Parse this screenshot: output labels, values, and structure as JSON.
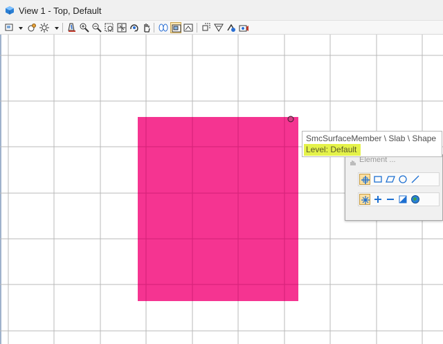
{
  "window": {
    "title": "View 1 - Top, Default",
    "app_icon": "view-cube-icon"
  },
  "toolbar": {
    "icons": [
      "view-attributes-icon",
      "dropdown-arrow-icon",
      "display-style-icon",
      "brightness-icon",
      "dropdown-arrow-icon",
      "update-view-icon",
      "zoom-in-icon",
      "zoom-out-icon",
      "window-area-icon",
      "fit-view-icon",
      "rotate-view-icon",
      "pan-view-icon",
      "view-previous-next-icon",
      "copy-view-icon",
      "view-toggle-icon",
      "clip-volume-icon",
      "clip-mask-icon",
      "clip-toggle-icon",
      "camera-icon"
    ],
    "active_icon": "copy-view-icon"
  },
  "view": {
    "shape_color": "#f52d8d",
    "grid_color": "#b8b8b8"
  },
  "tooltip": {
    "path": "SmcSurfaceMember \\ Slab \\ Shape",
    "level": "Level: Default",
    "highlight_color": "#e4f24a"
  },
  "accudraw_popup": {
    "title": "Element ...",
    "row1_icons": [
      "place-smartline-icon",
      "rectangle-icon",
      "parallelogram-icon",
      "circle-icon",
      "line-icon"
    ],
    "row2_icons": [
      "snap-star-icon",
      "add-icon",
      "subtract-icon",
      "fill-shape-icon",
      "globe-icon"
    ]
  }
}
